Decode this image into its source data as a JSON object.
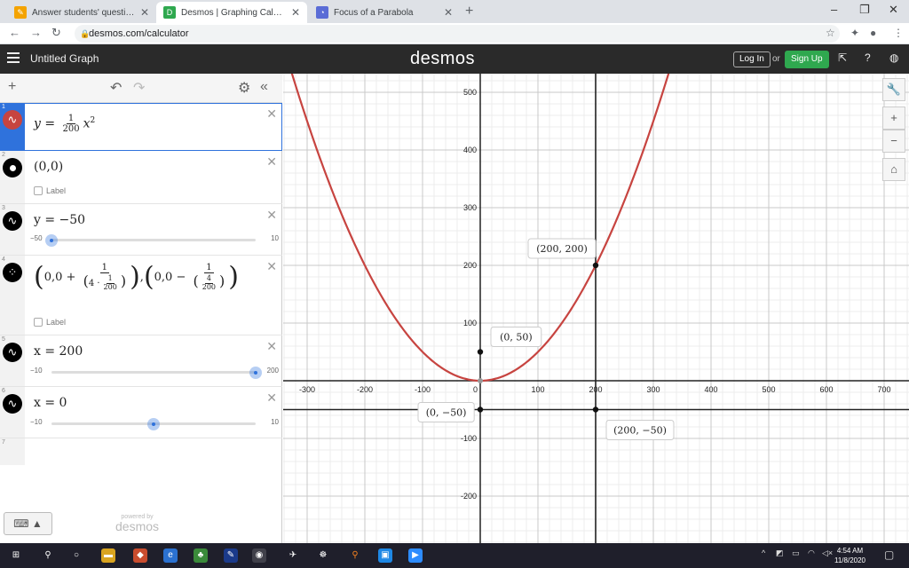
{
  "browser": {
    "tabs": [
      {
        "title": "Answer students' questions and",
        "fav": "✎",
        "color": "#f4a300"
      },
      {
        "title": "Desmos | Graphing Calculator",
        "fav": "D",
        "color": "#2fa84f"
      },
      {
        "title": "Focus of a Parabola",
        "fav": "◔",
        "color": "#5a6cd6"
      }
    ],
    "url": "desmos.com/calculator"
  },
  "header": {
    "graph_title": "Untitled Graph",
    "logo": "desmos",
    "login": "Log In",
    "or": "or",
    "signup": "Sign Up"
  },
  "expressions": [
    {
      "num": "1",
      "y_lhs": "y =",
      "frac_n": "1",
      "frac_d": "200",
      "var": "x",
      "exp": "2"
    },
    {
      "num": "2",
      "text": "(0,0)",
      "label": "Label"
    },
    {
      "num": "3",
      "text": "y = −50",
      "slider_min": "−50",
      "slider_max": "10",
      "value_frac": 0.0
    },
    {
      "num": "4",
      "label": "Label",
      "a": "0,0 +",
      "n1": "1",
      "d_pre": "4 ·",
      "d_n": "1",
      "d_d": "200",
      "b": "0,0 −",
      "n2": "1",
      "d2_n": "4",
      "d2_d": "200"
    },
    {
      "num": "5",
      "text": "x = 200",
      "slider_min": "−10",
      "slider_max": "200",
      "value_frac": 1.0
    },
    {
      "num": "6",
      "text": "x = 0",
      "slider_min": "−10",
      "slider_max": "10",
      "value_frac": 0.5
    },
    {
      "num": "7"
    }
  ],
  "footer": {
    "powered": "powered by",
    "brand": "desmos"
  },
  "graph": {
    "x_ticks": [
      "-300",
      "-200",
      "-100",
      "0",
      "100",
      "200",
      "300",
      "400",
      "500",
      "600",
      "700"
    ],
    "y_ticks": [
      "500",
      "400",
      "300",
      "200",
      "100",
      "-100",
      "-200"
    ],
    "curve_color": "#c74440",
    "points": [
      {
        "x": 200,
        "y": 200,
        "label": "(200, 200)"
      },
      {
        "x": 0,
        "y": 50,
        "label": "(0, 50)"
      },
      {
        "x": 0,
        "y": -50,
        "label": "(0, −50)"
      },
      {
        "x": 200,
        "y": -50,
        "label": "(200, −50)"
      }
    ]
  },
  "taskbar": {
    "time": "4:54 AM",
    "date": "11/8/2020"
  }
}
